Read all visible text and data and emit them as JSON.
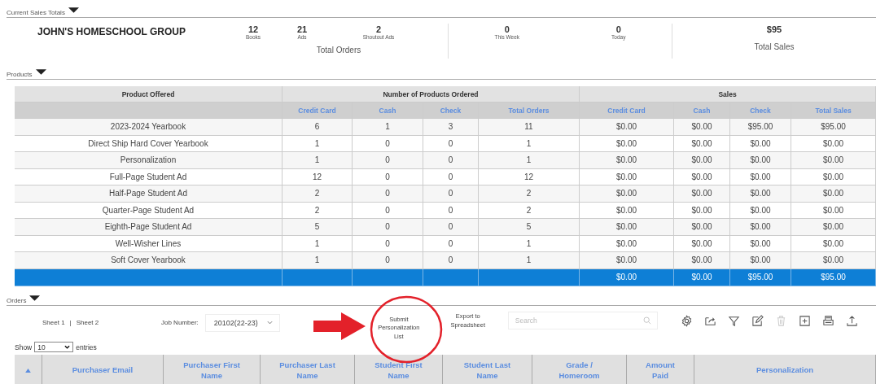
{
  "current_sales_totals": {
    "title": "Current Sales Totals",
    "group_name": "JOHN'S HOMESCHOOL GROUP",
    "order_stats": [
      {
        "value": "12",
        "label": "Books"
      },
      {
        "value": "21",
        "label": "Ads"
      },
      {
        "value": "2",
        "label": "Shoutout Ads"
      }
    ],
    "total_orders_label": "Total Orders",
    "period_stats": [
      {
        "value": "0",
        "label": "This Week"
      },
      {
        "value": "0",
        "label": "Today"
      }
    ],
    "total_sales": {
      "value": "$95",
      "label": "Total Sales"
    }
  },
  "products": {
    "title": "Products",
    "group_headers": [
      "Product Offered",
      "Number of Products Ordered",
      "Sales"
    ],
    "columns": [
      "",
      "Credit Card",
      "Cash",
      "Check",
      "Total Orders",
      "Credit Card",
      "Cash",
      "Check",
      "Total Sales"
    ],
    "rows": [
      [
        "2023-2024 Yearbook",
        "6",
        "1",
        "3",
        "11",
        "$0.00",
        "$0.00",
        "$95.00",
        "$95.00"
      ],
      [
        "Direct Ship Hard Cover Yearbook",
        "1",
        "0",
        "0",
        "1",
        "$0.00",
        "$0.00",
        "$0.00",
        "$0.00"
      ],
      [
        "Personalization",
        "1",
        "0",
        "0",
        "1",
        "$0.00",
        "$0.00",
        "$0.00",
        "$0.00"
      ],
      [
        "Full-Page Student Ad",
        "12",
        "0",
        "0",
        "12",
        "$0.00",
        "$0.00",
        "$0.00",
        "$0.00"
      ],
      [
        "Half-Page Student Ad",
        "2",
        "0",
        "0",
        "2",
        "$0.00",
        "$0.00",
        "$0.00",
        "$0.00"
      ],
      [
        "Quarter-Page Student Ad",
        "2",
        "0",
        "0",
        "2",
        "$0.00",
        "$0.00",
        "$0.00",
        "$0.00"
      ],
      [
        "Eighth-Page Student Ad",
        "5",
        "0",
        "0",
        "5",
        "$0.00",
        "$0.00",
        "$0.00",
        "$0.00"
      ],
      [
        "Well-Wisher Lines",
        "1",
        "0",
        "0",
        "1",
        "$0.00",
        "$0.00",
        "$0.00",
        "$0.00"
      ],
      [
        "Soft Cover Yearbook",
        "1",
        "0",
        "0",
        "1",
        "$0.00",
        "$0.00",
        "$0.00",
        "$0.00"
      ]
    ],
    "total_row": [
      "$0.00",
      "$0.00",
      "$95.00",
      "$95.00"
    ]
  },
  "orders": {
    "title": "Orders",
    "sheets": [
      "Sheet 1",
      "Sheet 2"
    ],
    "sheet_separator": "|",
    "job_number_label": "Job Number:",
    "job_number": "20102(22-23)",
    "submit_button": "Submit Personalization List",
    "export_button": "Export to Spreadsheet",
    "search": {
      "placeholder": "Search"
    },
    "toolbar": [
      {
        "kind": "settings",
        "disabled": false
      },
      {
        "kind": "share",
        "disabled": false
      },
      {
        "kind": "filter",
        "disabled": false
      },
      {
        "kind": "edit",
        "disabled": false
      },
      {
        "kind": "delete",
        "disabled": true
      },
      {
        "kind": "add",
        "disabled": false
      },
      {
        "kind": "print",
        "disabled": false
      },
      {
        "kind": "upload",
        "disabled": false
      }
    ],
    "show_label": "Show",
    "page_size": "10",
    "entries_label": "entries",
    "columns": [
      "Purchaser Email",
      "Purchaser First Name",
      "Purchaser Last Name",
      "Student First Name",
      "Student Last Name",
      "Grade / Homeroom",
      "Amount Paid",
      "Personalization"
    ]
  }
}
